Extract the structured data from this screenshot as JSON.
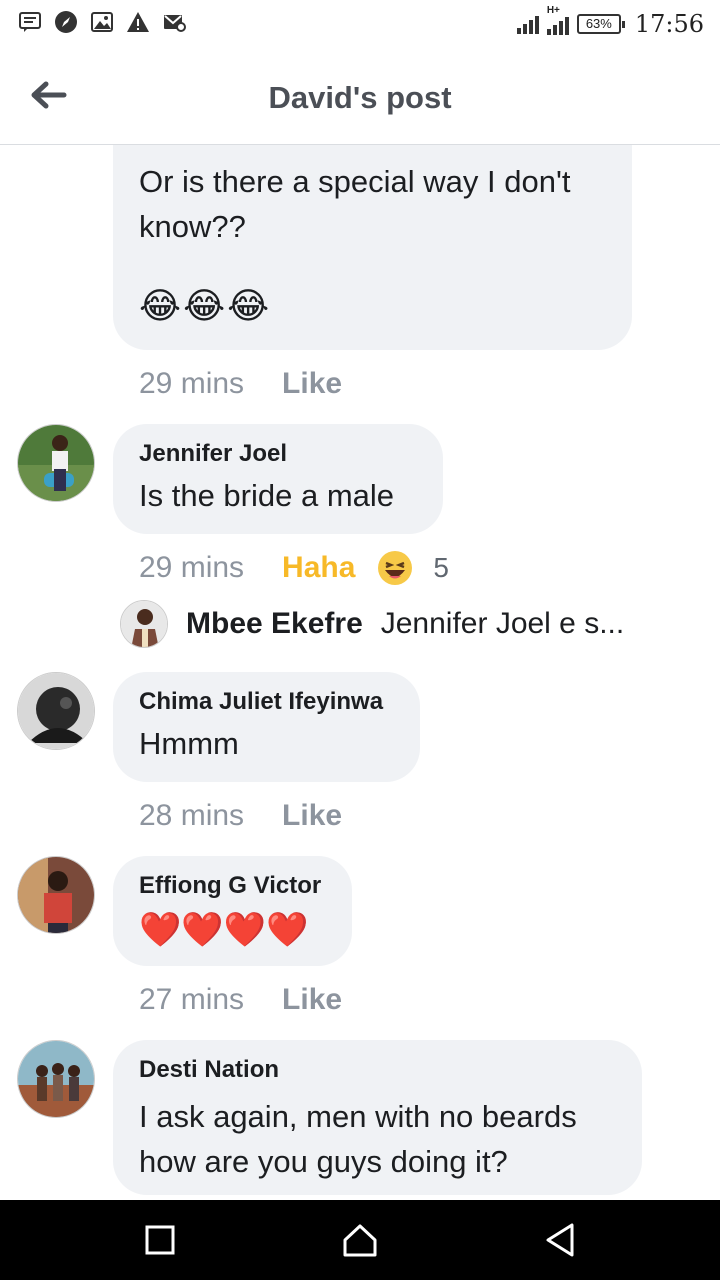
{
  "status_bar": {
    "battery": "63%",
    "time": "17:56",
    "network": "H+"
  },
  "header": {
    "title": "David's post"
  },
  "comments": [
    {
      "text": "Or is there a special way I don't know??",
      "emoji": "😂😂😂",
      "time": "29 mins",
      "action": "Like"
    },
    {
      "author": "Jennifer Joel",
      "text": "Is the bride a male",
      "time": "29 mins",
      "action": "Haha",
      "reaction_count": "5",
      "reply": {
        "author": "Mbee Ekefre",
        "text": "Jennifer Joel e s..."
      }
    },
    {
      "author": "Chima Juliet Ifeyinwa",
      "text": "Hmmm",
      "time": "28 mins",
      "action": "Like"
    },
    {
      "author": "Effiong G Victor",
      "emoji": "❤️❤️❤️❤️",
      "time": "27 mins",
      "action": "Like"
    },
    {
      "author": "Desti Nation",
      "text": "I ask again, men with no beards how are you guys doing it?"
    }
  ],
  "colors": {
    "bubble": "#f0f2f5",
    "haha": "#f7b928",
    "meta": "#8d949e"
  }
}
